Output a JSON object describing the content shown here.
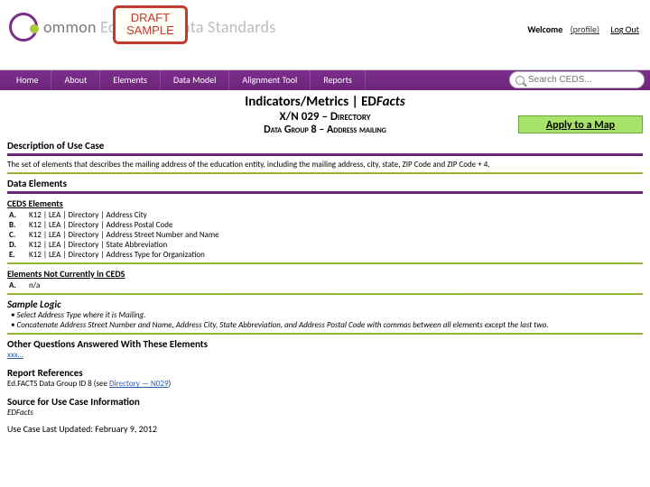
{
  "header": {
    "logo_text_prefix": "ommon ",
    "logo_text_rest": "Education Data Standards",
    "draft_line1": "DRAFT",
    "draft_line2": "SAMPLE",
    "welcome": "Welcome",
    "profile": "(profile)",
    "logout": "Log Out"
  },
  "nav": {
    "items": [
      "Home",
      "About",
      "Elements",
      "Data Model",
      "Alignment Tool",
      "Reports"
    ],
    "search_placeholder": "Search CEDS..."
  },
  "title": {
    "l1a": "Indicators/Metrics | ED",
    "l1b": "Facts",
    "l2": "X/N 029 – Directory",
    "l3": "Data Group 8 – Address mailing",
    "apply": "Apply to a Map"
  },
  "description": {
    "head": "Description of Use Case",
    "text": "The set of elements that describes the mailing address of the education entity, including the mailing address, city, state, ZIP Code and ZIP Code + 4."
  },
  "data_elements": {
    "head": "Data Elements",
    "ceds_head": "CEDS Elements",
    "rows": [
      {
        "lbl": "A.",
        "txt": "K12 | LEA | Directory | Address City"
      },
      {
        "lbl": "B.",
        "txt": "K12 | LEA | Directory | Address Postal Code"
      },
      {
        "lbl": "C.",
        "txt": "K12 | LEA | Directory | Address Street Number and Name"
      },
      {
        "lbl": "D.",
        "txt": "K12 | LEA | Directory | State Abbreviation"
      },
      {
        "lbl": "E.",
        "txt": "K12 | LEA | Directory | Address Type for Organization"
      }
    ],
    "not_in_head": "Elements Not Currently in CEDS",
    "not_in_rows": [
      {
        "lbl": "A.",
        "txt": "n/a"
      }
    ]
  },
  "sample_logic": {
    "head": "Sample Logic",
    "items": [
      "Select Address Type where it is Mailing.",
      "Concatenate Address Street Number and Name, Address City, State Abbreviation, and Address Postal Code with commas between all elements except the last two."
    ]
  },
  "other_q": {
    "head": "Other Questions Answered With These Elements",
    "link": "xxx…"
  },
  "report_ref": {
    "head": "Report References",
    "prefix": "Ed.FACTS Data Group ID 8 (see ",
    "link": "Directory — N029",
    "suffix": ")"
  },
  "source": {
    "head": "Source for Use Case Information",
    "text": "EDFacts"
  },
  "updated": "Use Case Last Updated: February 9, 2012"
}
